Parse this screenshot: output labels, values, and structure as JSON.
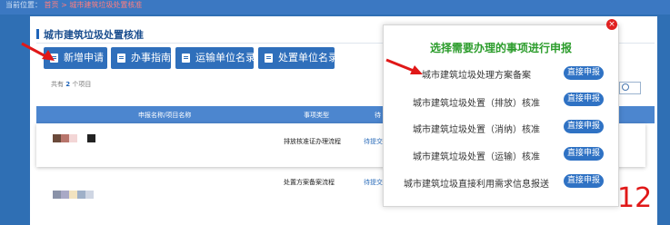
{
  "breadcrumb": {
    "home": "当前位置：",
    "path": "首页 > 城市建筑垃圾处置核准"
  },
  "page": {
    "title": "城市建筑垃圾处置核准"
  },
  "toolbar": [
    {
      "label": "新增申请"
    },
    {
      "label": "办事指南"
    },
    {
      "label": "运输单位名录"
    },
    {
      "label": "处置单位名录"
    }
  ],
  "list": {
    "count_prefix": "共有",
    "count": "2",
    "count_suffix": "个项目",
    "headers": {
      "name": "申报名称/项目名称",
      "type": "事项类型",
      "status": "待"
    },
    "rows": [
      {
        "type": "排放核准证办理流程",
        "status": "待提交"
      },
      {
        "type": "处置方案备案流程",
        "status": "待提交"
      }
    ]
  },
  "modal": {
    "title": "选择需要办理的事项进行申报",
    "options": [
      {
        "label": "城市建筑垃圾处理方案备案",
        "action": "直接申报"
      },
      {
        "label": "城市建筑垃圾处置（排放）核准",
        "action": "直接申报"
      },
      {
        "label": "城市建筑垃圾处置（消纳）核准",
        "action": "直接申报"
      },
      {
        "label": "城市建筑垃圾处置（运输）核准",
        "action": "直接申报"
      },
      {
        "label": "城市建筑垃圾直接利用需求信息报送",
        "action": "直接申报"
      }
    ],
    "close": "×"
  },
  "annotation": {
    "step": "12"
  },
  "colors": {
    "primary": "#2f6fbb",
    "title_green": "#2b9c2b",
    "arrow_red": "#e01818"
  }
}
